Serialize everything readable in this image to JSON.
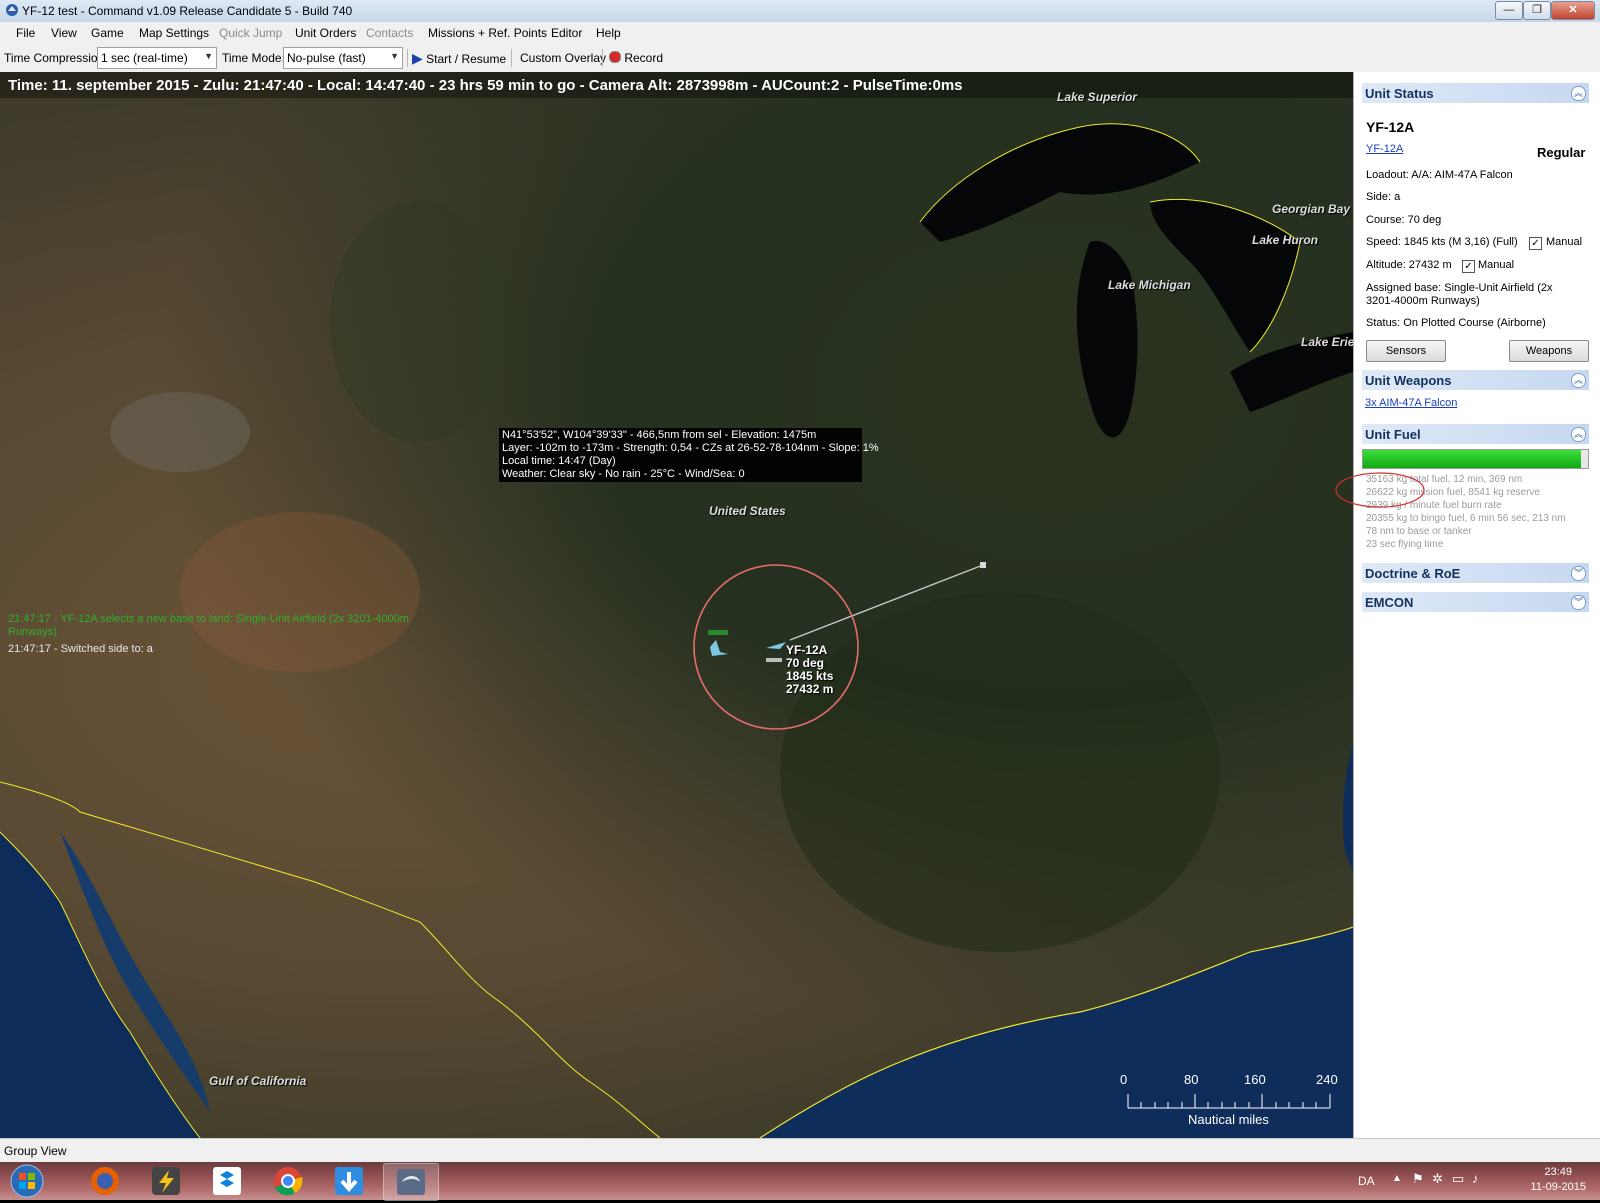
{
  "window": {
    "title": "YF-12 test - Command v1.09 Release Candidate 5 - Build 740",
    "controls": [
      "minimize",
      "restore",
      "close"
    ]
  },
  "menu": {
    "items": [
      "File",
      "View",
      "Game",
      "Map Settings",
      "Quick Jump",
      "Unit Orders",
      "Contacts",
      "Missions + Ref. Points",
      "Editor",
      "Help"
    ],
    "disabled": [
      "Quick Jump",
      "Contacts"
    ]
  },
  "toolbar": {
    "time_compression_label": "Time Compression:",
    "time_compression_value": "1 sec (real-time)",
    "time_mode_label": "Time Mode:",
    "time_mode_value": "No-pulse (fast)",
    "start_resume": "Start / Resume",
    "custom_overlay": "Custom Overlay",
    "record": "Record"
  },
  "map": {
    "status_line": "Time: 11. september 2015 - Zulu: 21:47:40 - Local: 14:47:40 - 23 hrs 59 min to go -  Camera Alt: 2873998m - AUCount:2 - PulseTime:0ms",
    "labels": {
      "lake_superior": "Lake Superior",
      "georgian_bay": "Georgian Bay",
      "lake_huron": "Lake Huron",
      "lake_michigan": "Lake Michigan",
      "lake_erie": "Lake Erie",
      "united_states": "United States",
      "gulf_of_california": "Gulf of California"
    },
    "tooltip": [
      "N41°53'52\", W104°39'33\" - 466,5nm from sel - Elevation: 1475m",
      "Layer: -102m to -173m - Strength: 0,54 - CZs at 26-52-78-104nm - Slope: 1%",
      "Local time: 14:47 (Day)",
      "Weather: Clear sky - No rain - 25°C - Wind/Sea: 0"
    ],
    "messages": [
      {
        "text": "21:47:17 - YF-12A selects a new base to land: Single-Unit Airfield (2x 3201-4000m",
        "color": "#2fae2f"
      },
      {
        "text": "Runways)",
        "color": "#2fae2f"
      },
      {
        "text": "21:47:17 - Switched side to: a",
        "color": "#e8e8e8"
      }
    ],
    "unit_label": [
      "YF-12A",
      "70 deg",
      "1845 kts",
      "27432 m"
    ],
    "scale": {
      "ticks": [
        "0",
        "80",
        "160",
        "240"
      ],
      "unit": "Nautical miles"
    },
    "colors": {
      "borders": "#f2ea2c",
      "range_circle": "#e86b6b",
      "annotation": "#d23030"
    }
  },
  "panel": {
    "unit_status": {
      "header": "Unit Status",
      "unit_name": "YF-12A",
      "class_link": "YF-12A",
      "proficiency": "Regular",
      "loadout": "Loadout: A/A: AIM-47A Falcon",
      "side": "Side: a",
      "course": "Course: 70 deg",
      "speed": "Speed: 1845 kts (M 3,16) (Full)",
      "speed_manual": "Manual",
      "altitude": "Altitude: 27432 m",
      "altitude_manual": "Manual",
      "assigned_base_1": "Assigned base: Single-Unit Airfield (2x",
      "assigned_base_2": "3201-4000m Runways)",
      "status": "Status: On Plotted Course (Airborne)",
      "sensors_btn": "Sensors",
      "weapons_btn": "Weapons"
    },
    "unit_weapons": {
      "header": "Unit Weapons",
      "item": "3x AIM-47A Falcon"
    },
    "unit_fuel": {
      "header": "Unit Fuel",
      "fuel_fraction": 0.97,
      "lines": [
        "35163 kg total fuel, 12 min, 369 nm",
        "26622 kg mission fuel, 8541 kg reserve",
        "2939 kg / minute fuel burn rate",
        "20355 kg to bingo fuel, 6 min 56 sec, 213 nm",
        "78 nm to base or tanker",
        "23 sec flying time"
      ]
    },
    "doctrine": {
      "header": "Doctrine & RoE"
    },
    "emcon": {
      "header": "EMCON"
    }
  },
  "statusbar": {
    "group_view": "Group View"
  },
  "taskbar": {
    "apps": [
      "start-orb",
      "firefox",
      "winamp",
      "dropbox",
      "chrome",
      "downloader",
      "command"
    ],
    "language": "DA",
    "time": "23:49",
    "date": "11-09-2015"
  }
}
